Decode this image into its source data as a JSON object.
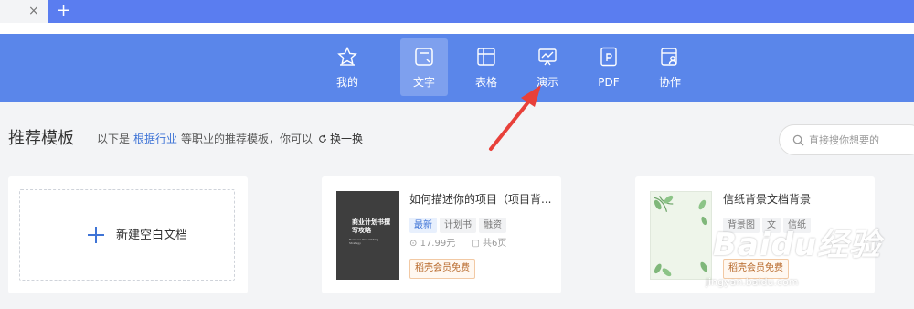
{
  "tabbar": {
    "close_glyph": "×",
    "add_glyph": "+"
  },
  "nav": {
    "items": [
      {
        "label": "我的",
        "icon": "star-icon"
      },
      {
        "label": "文字",
        "icon": "document-icon",
        "active": true
      },
      {
        "label": "表格",
        "icon": "table-icon"
      },
      {
        "label": "演示",
        "icon": "presentation-icon"
      },
      {
        "label": "PDF",
        "icon": "pdf-icon"
      },
      {
        "label": "协作",
        "icon": "collaborate-icon"
      }
    ]
  },
  "section": {
    "title": "推荐模板",
    "hint_prefix": "以下是",
    "hint_link": "根据行业",
    "hint_suffix": "等职业的推荐模板，你可以",
    "refresh_label": "换一换",
    "refresh_icon": "refresh-icon"
  },
  "search": {
    "placeholder": "直接搜你想要的",
    "value": ""
  },
  "new_doc": {
    "label": "新建空白文档"
  },
  "templates": [
    {
      "title": "如何描述你的项目（项目背...",
      "thumb_title": "商业计划书撰写攻略",
      "thumb_sub": "Business Plan Writing Strategy",
      "tags": [
        "最新",
        "计划书",
        "融资"
      ],
      "price": "17.99元",
      "pages": "共6页",
      "badge": "稻壳会员免费"
    },
    {
      "title": "信纸背景文档背景",
      "tags": [
        "背景图",
        "文",
        "信纸"
      ],
      "badge": "稻壳会员免费"
    }
  ],
  "watermark": {
    "text": "Baidu经验",
    "url": "jingyan.baidu.com"
  },
  "colors": {
    "brand_blue": "#5a86ea",
    "tab_blue": "#5a7df0",
    "arrow_red": "#e8403a",
    "link_blue": "#3f74d6"
  }
}
